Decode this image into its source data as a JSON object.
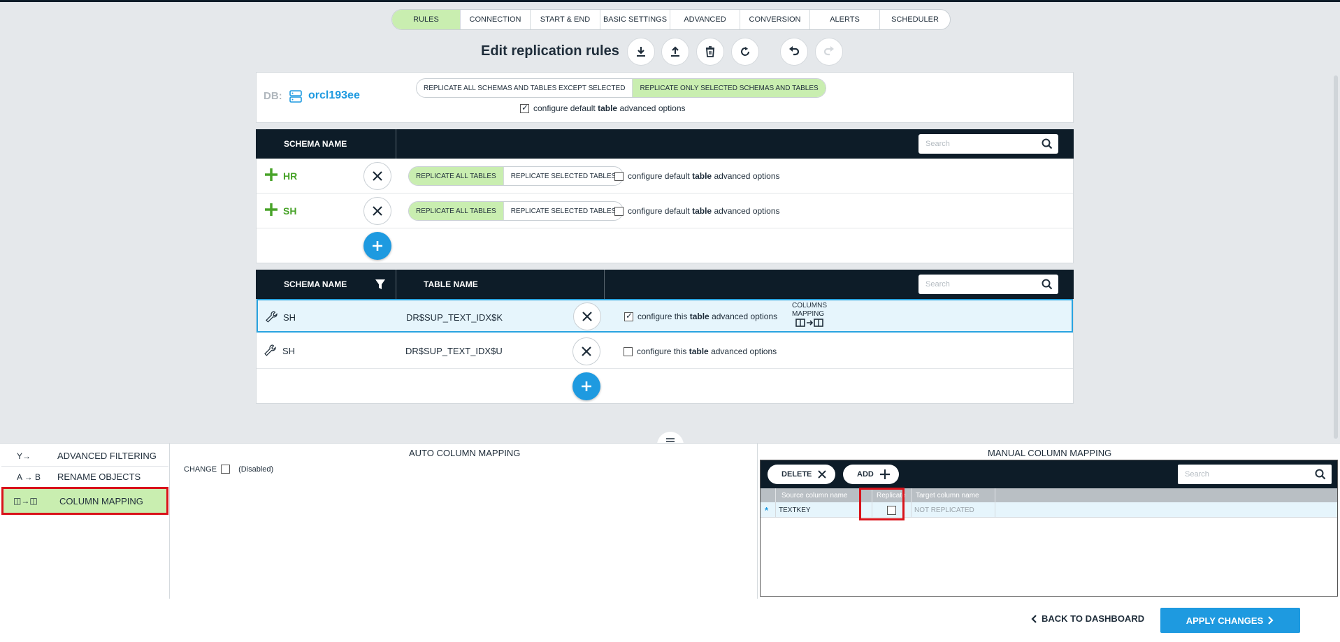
{
  "tabs": [
    "RULES",
    "CONNECTION",
    "START & END",
    "BASIC SETTINGS",
    "ADVANCED",
    "CONVERSION",
    "ALERTS",
    "SCHEDULER"
  ],
  "active_tab": "RULES",
  "title": "Edit replication rules",
  "db": {
    "label": "DB:",
    "name": "orcl193ee",
    "mode_options": [
      "REPLICATE ALL SCHEMAS AND TABLES EXCEPT SELECTED",
      "REPLICATE ONLY SELECTED SCHEMAS AND TABLES"
    ],
    "active_mode": "REPLICATE ONLY SELECTED SCHEMAS AND TABLES",
    "default_opt_prefix": "configure default",
    "default_opt_bold": "table",
    "default_opt_suffix": "advanced options",
    "default_opt_checked": true
  },
  "schemas_table": {
    "header": "SCHEMA NAME",
    "search_placeholder": "Search",
    "rows": [
      {
        "name": "HR",
        "opt_all": "REPLICATE ALL TABLES",
        "opt_selected": "REPLICATE SELECTED TABLES",
        "opt_prefix": "configure default",
        "opt_bold": "table",
        "opt_suffix": "advanced options",
        "checked": false
      },
      {
        "name": "SH",
        "opt_all": "REPLICATE ALL TABLES",
        "opt_selected": "REPLICATE SELECTED TABLES",
        "opt_prefix": "configure default",
        "opt_bold": "table",
        "opt_suffix": "advanced options",
        "checked": false
      }
    ]
  },
  "tables_table": {
    "schema_header": "SCHEMA NAME",
    "table_header": "TABLE NAME",
    "search_placeholder": "Search",
    "rows": [
      {
        "schema": "SH",
        "table": "DR$SUP_TEXT_IDX$K",
        "opt_prefix": "configure this",
        "opt_bold": "table",
        "opt_suffix": "advanced options",
        "checked": true,
        "colmap_line1": "COLUMNS",
        "colmap_line2": "MAPPING"
      },
      {
        "schema": "SH",
        "table": "DR$SUP_TEXT_IDX$U",
        "opt_prefix": "configure this",
        "opt_bold": "table",
        "opt_suffix": "advanced options",
        "checked": false
      }
    ]
  },
  "bottom_nav": [
    {
      "icon": "Y→",
      "label": "ADVANCED FILTERING"
    },
    {
      "icon": "A → B",
      "label": "RENAME OBJECTS"
    },
    {
      "icon": "◫→◫",
      "label": "COLUMN MAPPING"
    }
  ],
  "auto_mapping": {
    "title": "AUTO COLUMN MAPPING",
    "change_label": "CHANGE",
    "disabled_label": "(Disabled)"
  },
  "manual_mapping": {
    "title": "MANUAL COLUMN MAPPING",
    "delete_label": "DELETE",
    "add_label": "ADD",
    "search_placeholder": "Search",
    "columns": [
      "Source column name",
      "Replicate",
      "Target column name"
    ],
    "row": {
      "marker": "*",
      "source": "TEXTKEY",
      "replicate": false,
      "target": "NOT REPLICATED"
    }
  },
  "footer": {
    "back_label": "BACK TO DASHBOARD",
    "apply_label": "APPLY CHANGES"
  },
  "colors": {
    "accent": "#1e9ae0",
    "active_green": "#c9eeb0",
    "dark_header": "#0d1c28",
    "highlight_red": "#d9131b",
    "schema_green": "#48a329"
  }
}
